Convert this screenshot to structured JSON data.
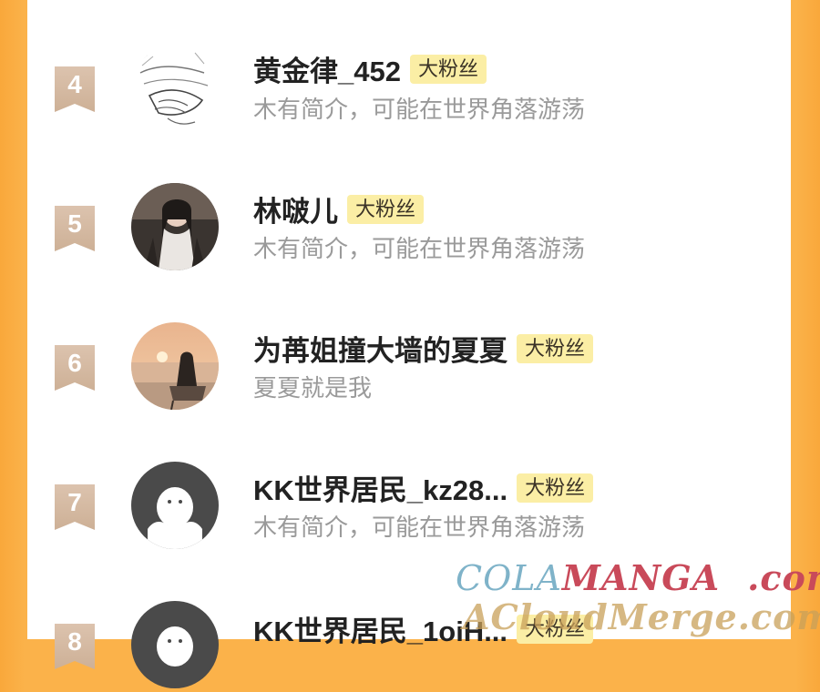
{
  "badge_label": "大粉丝",
  "rows": [
    {
      "rank": "4",
      "name": "黄金律_452",
      "bio": "木有简介，可能在世界角落游荡",
      "avatar": "sketch-hands"
    },
    {
      "rank": "5",
      "name": "林啵儿",
      "bio": "木有简介，可能在世界角落游荡",
      "avatar": "photo-girl-scarf"
    },
    {
      "rank": "6",
      "name": "为苒姐撞大墙的夏夏",
      "bio": "夏夏就是我",
      "avatar": "photo-sunset-sea"
    },
    {
      "rank": "7",
      "name": "KK世界居民_kz28...",
      "bio": "木有简介，可能在世界角落游荡",
      "avatar": "default-avatar"
    },
    {
      "rank": "8",
      "name": "KK世界居民_1oiH...",
      "bio": "",
      "avatar": "default-avatar"
    }
  ],
  "watermark": {
    "line1_a": "COLA",
    "line1_b": "MANGA",
    "line1_c": ".com",
    "line2": "ACloudMerge.com"
  },
  "colors": {
    "side_bars": "#fbb24a",
    "badge_bg": "#fbeea5",
    "rank_flag": "#cdb096"
  }
}
